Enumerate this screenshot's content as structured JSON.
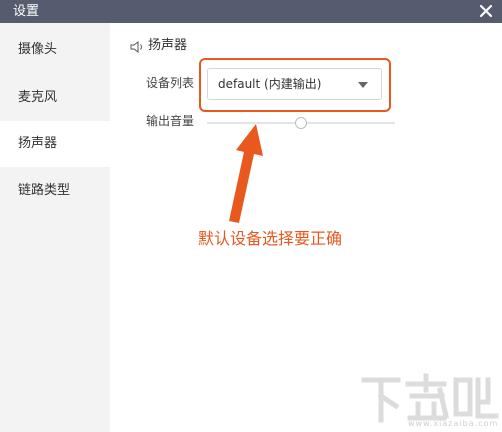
{
  "window": {
    "title": "设置",
    "close_icon": "close-icon"
  },
  "sidebar": {
    "items": [
      {
        "label": "摄像头",
        "active": false
      },
      {
        "label": "麦克风",
        "active": false
      },
      {
        "label": "扬声器",
        "active": true
      },
      {
        "label": "链路类型",
        "active": false
      }
    ]
  },
  "main": {
    "section_title": "扬声器",
    "section_icon": "speaker-icon",
    "device_label": "设备列表",
    "device_value": "default (内建输出)",
    "volume_label": "输出音量",
    "volume_level": 0.5
  },
  "annotation": {
    "text": "默认设备选择要正确",
    "color": "#e8581f"
  },
  "watermark": {
    "url": "www.xiazaiba.com"
  },
  "colors": {
    "titlebar": "#565c6e",
    "sidebar": "#f3f3f3",
    "accent": "#e8581f"
  }
}
